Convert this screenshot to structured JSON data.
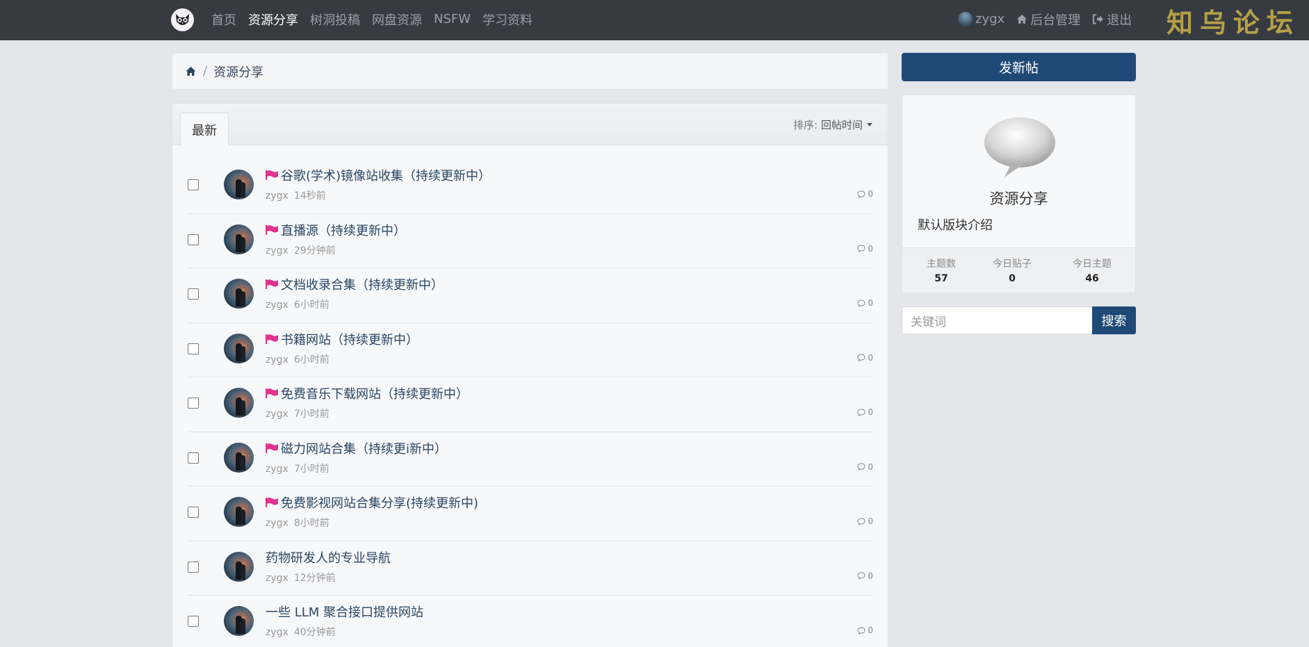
{
  "navbar": {
    "logo_icon": "owl-logo-icon",
    "links": [
      {
        "label": "首页",
        "active": false
      },
      {
        "label": "资源分享",
        "active": true
      },
      {
        "label": "树洞投稿",
        "active": false
      },
      {
        "label": "网盘资源",
        "active": false
      },
      {
        "label": "NSFW",
        "active": false
      },
      {
        "label": "学习资料",
        "active": false
      }
    ],
    "user": {
      "name": "zygx"
    },
    "admin_label": "后台管理",
    "logout_label": "退出",
    "brand_title": "知乌论坛",
    "background": "#363a41",
    "brand_color": "#b5a046"
  },
  "breadcrumb": {
    "home_icon": "home-icon",
    "current": "资源分享"
  },
  "thread_list": {
    "tab_label": "最新",
    "sort_label": "排序:",
    "sort_value": "回帖时间",
    "threads": [
      {
        "title": "谷歌(学术)镜像站收集（持续更新中）",
        "pinned": true,
        "author": "zygx",
        "time": "14秒前",
        "replies": "0"
      },
      {
        "title": "直播源（持续更新中）",
        "pinned": true,
        "author": "zygx",
        "time": "29分钟前",
        "replies": "0"
      },
      {
        "title": "文档收录合集（持续更新中）",
        "pinned": true,
        "author": "zygx",
        "time": "6小时前",
        "replies": "0"
      },
      {
        "title": "书籍网站（持续更新中）",
        "pinned": true,
        "author": "zygx",
        "time": "6小时前",
        "replies": "0"
      },
      {
        "title": "免费音乐下载网站（持续更新中）",
        "pinned": true,
        "author": "zygx",
        "time": "7小时前",
        "replies": "0"
      },
      {
        "title": "磁力网站合集（持续更i新中）",
        "pinned": true,
        "author": "zygx",
        "time": "7小时前",
        "replies": "0"
      },
      {
        "title": "免费影视网站合集分享(持续更新中)",
        "pinned": true,
        "author": "zygx",
        "time": "8小时前",
        "replies": "0"
      },
      {
        "title": "药物研发人的专业导航",
        "pinned": false,
        "author": "zygx",
        "time": "12分钟前",
        "replies": "0"
      },
      {
        "title": "一些 LLM 聚合接口提供网站",
        "pinned": false,
        "author": "zygx",
        "time": "40分钟前",
        "replies": "0"
      }
    ],
    "flag_color": "#e0338f",
    "link_color": "#2a4563"
  },
  "sidebar": {
    "new_post_label": "发新帖",
    "forum_icon": "speech-bubble-icon",
    "forum_name": "资源分享",
    "forum_desc": "默认版块介绍",
    "stats": [
      {
        "label": "主题数",
        "value": "57"
      },
      {
        "label": "今日贴子",
        "value": "0"
      },
      {
        "label": "今日主题",
        "value": "46"
      }
    ],
    "search_placeholder": "关键词",
    "search_label": "搜索",
    "accent": "#1f4a78"
  }
}
